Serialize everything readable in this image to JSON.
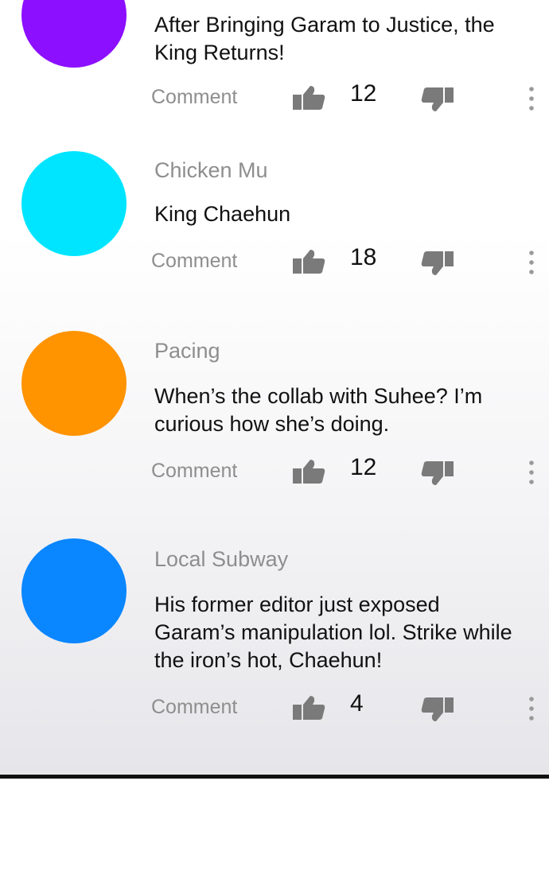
{
  "comments": [
    {
      "avatar_color": "#8c0fff",
      "username": "",
      "text": "After Bringing Garam to Justice, the King Returns!",
      "reply_label": "Comment",
      "likes": "12"
    },
    {
      "avatar_color": "#00e5ff",
      "username": "Chicken Mu",
      "text": "King Chaehun",
      "reply_label": "Comment",
      "likes": "18"
    },
    {
      "avatar_color": "#ff9300",
      "username": "Pacing",
      "text": "When’s the collab with Suhee? I’m curious how she’s doing.",
      "reply_label": "Comment",
      "likes": "12"
    },
    {
      "avatar_color": "#0a86ff",
      "username": "Local Subway",
      "text": "His former editor just exposed Garam’s manipulation lol. Strike while the iron’s hot, Chaehun!",
      "reply_label": "Comment",
      "likes": "4"
    }
  ],
  "icons": {
    "like": "thumbs-up-icon",
    "dislike": "thumbs-down-icon",
    "more": "more-vertical-icon"
  }
}
